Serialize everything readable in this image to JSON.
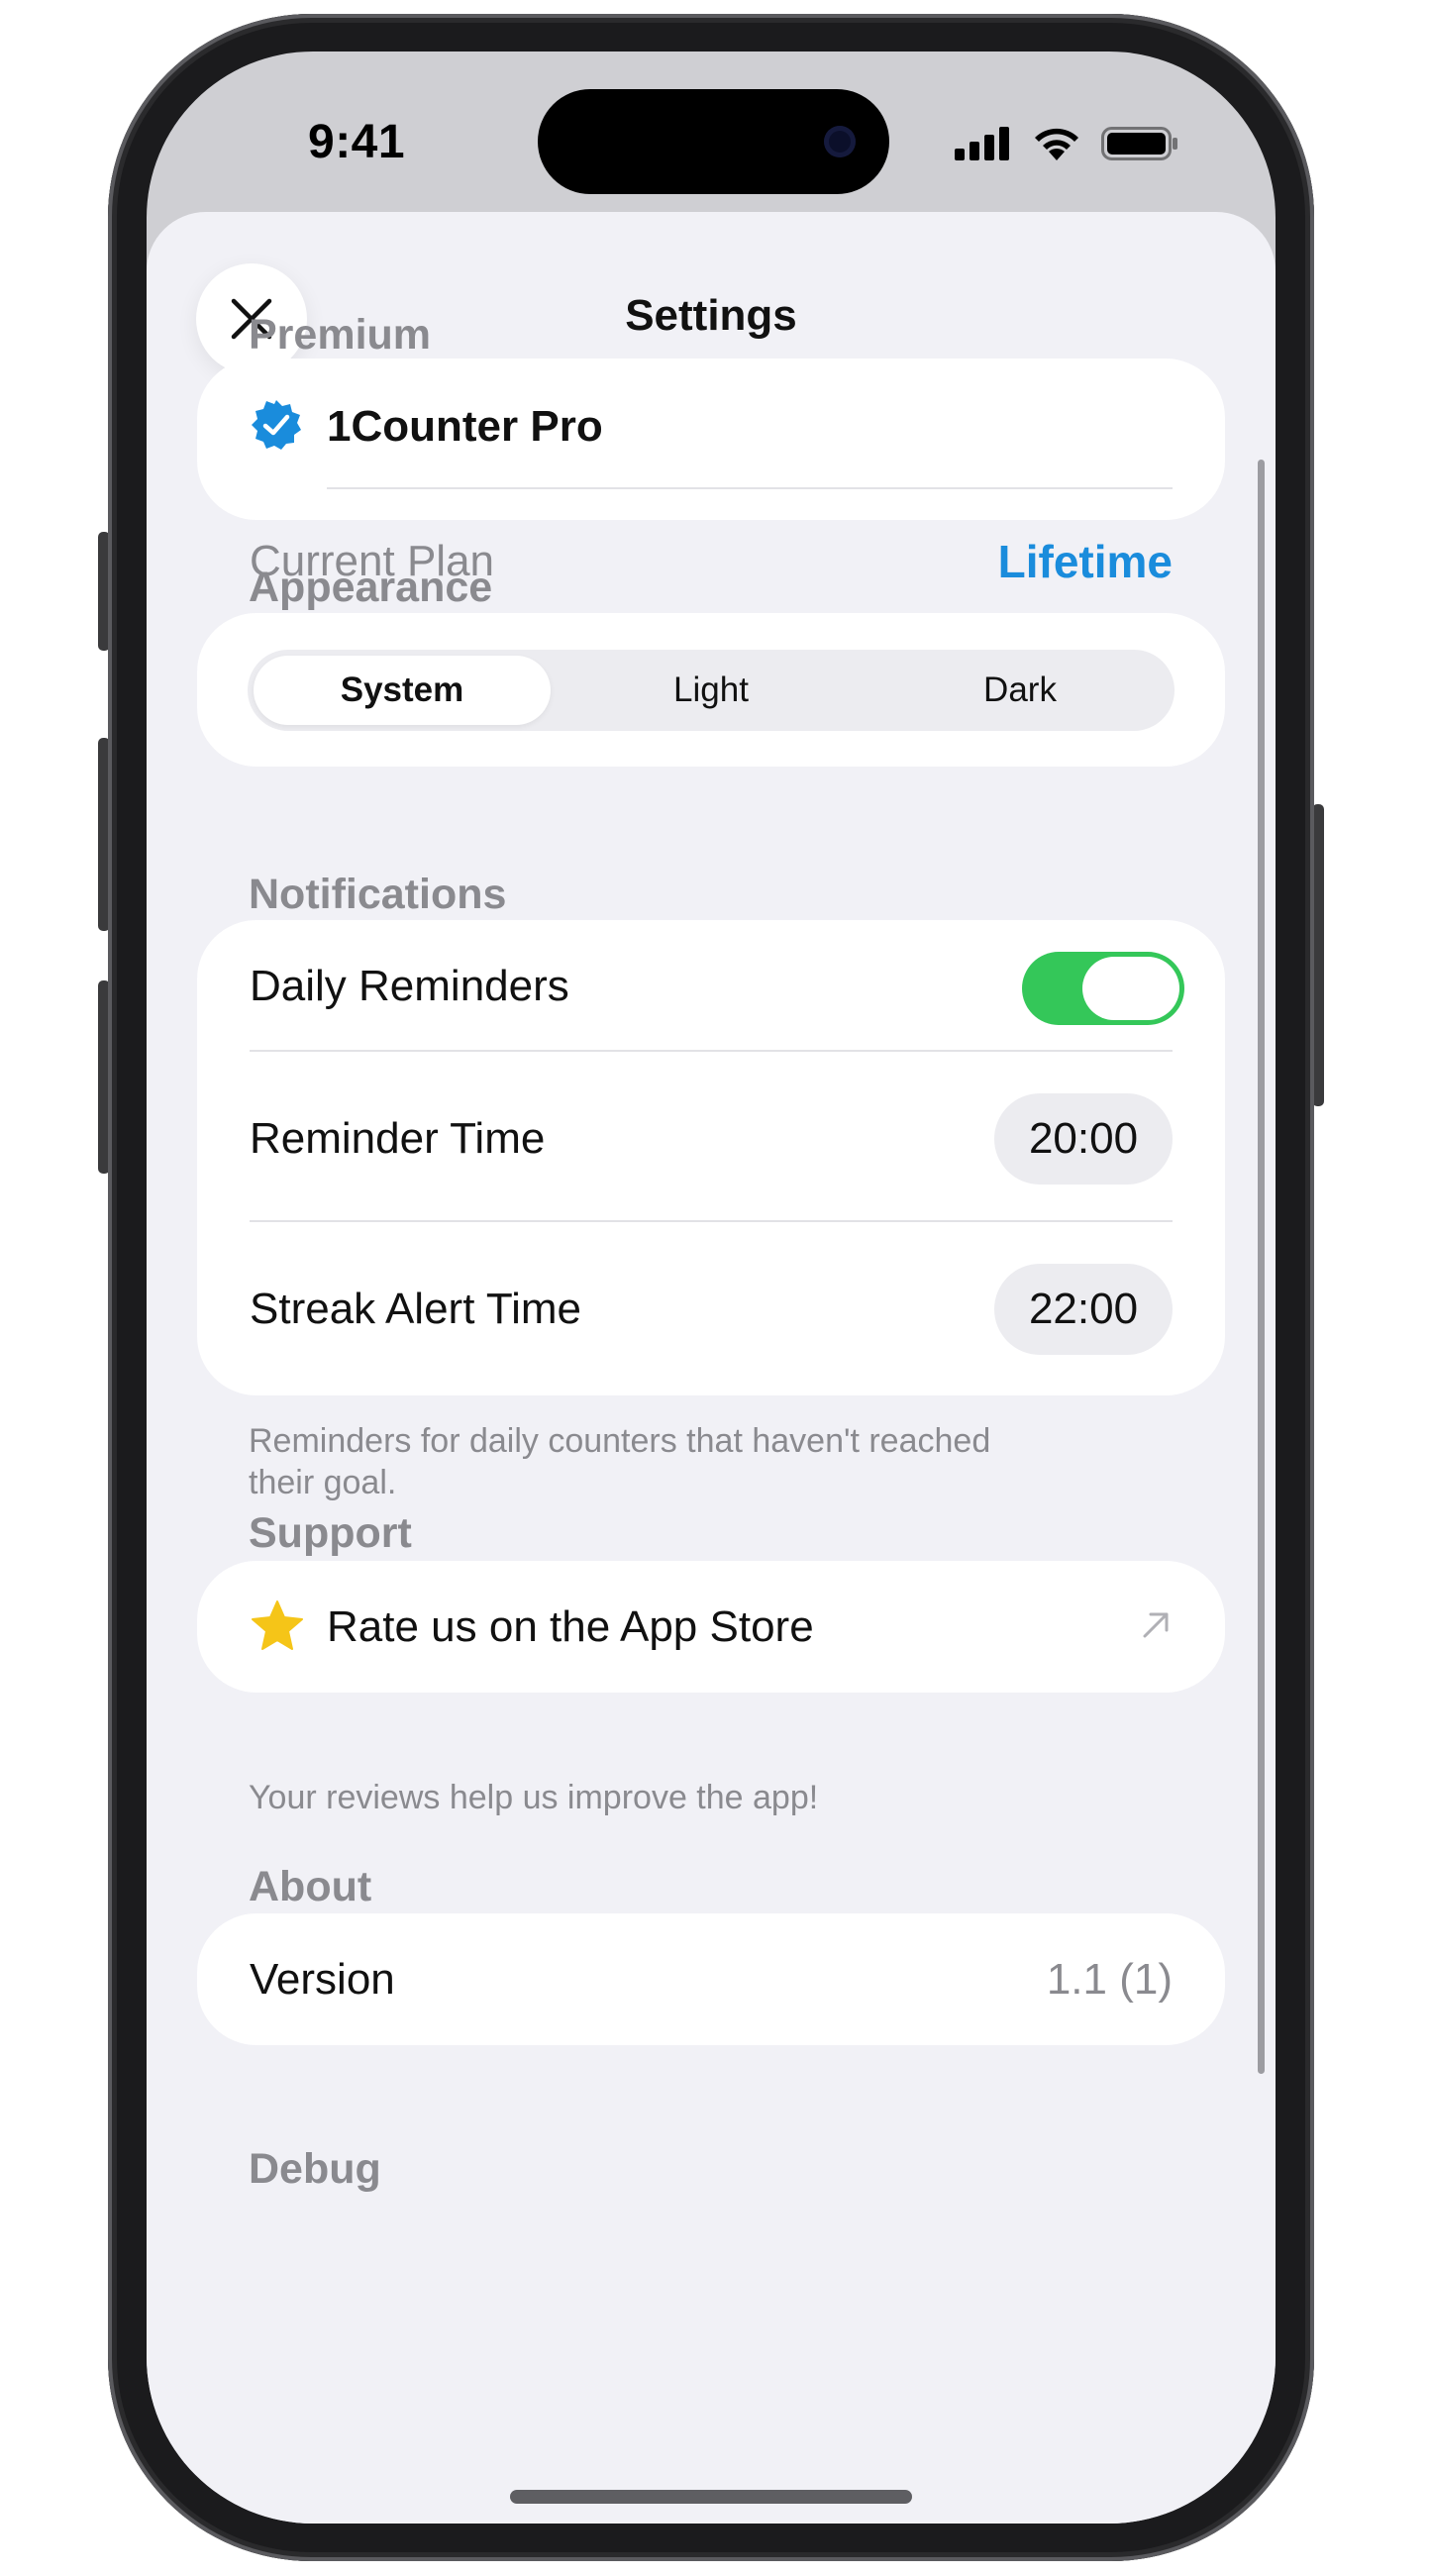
{
  "status_bar": {
    "time": "9:41"
  },
  "sheet": {
    "title": "Settings"
  },
  "premium": {
    "header": "Premium",
    "product_name": "1Counter Pro",
    "plan_label": "Current Plan",
    "plan_value": "Lifetime",
    "accent_color": "#1a8cdc"
  },
  "appearance": {
    "header": "Appearance",
    "options": [
      "System",
      "Light",
      "Dark"
    ],
    "selected": "System"
  },
  "notifications": {
    "header": "Notifications",
    "daily_reminders_label": "Daily Reminders",
    "daily_reminders_on": true,
    "reminder_time_label": "Reminder Time",
    "reminder_time_value": "20:00",
    "streak_alert_label": "Streak Alert Time",
    "streak_alert_value": "22:00",
    "footnote": "Reminders for daily counters that haven't reached their goal.",
    "toggle_color": "#34c759"
  },
  "support": {
    "header": "Support",
    "rate_label": "Rate us on the App Store",
    "footnote": "Your reviews help us improve the app!"
  },
  "about": {
    "header": "About",
    "version_label": "Version",
    "version_value": "1.1 (1)"
  },
  "debug": {
    "header": "Debug"
  },
  "icons": {
    "close": "close-icon",
    "verified": "verified-badge-icon",
    "star": "star-icon",
    "external_link": "external-link-icon"
  }
}
